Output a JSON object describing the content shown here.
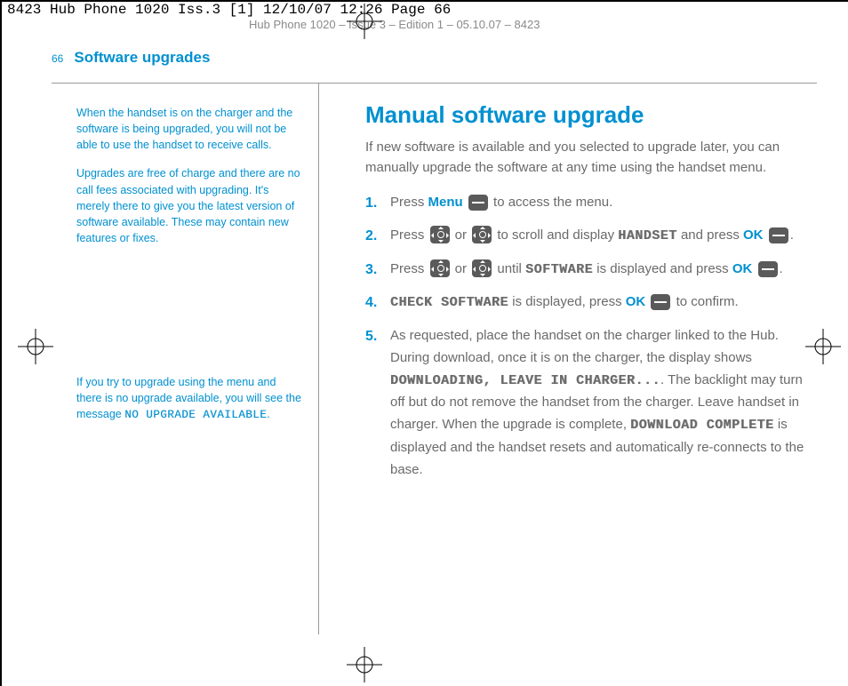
{
  "header": {
    "line1": "8423 Hub Phone 1020 Iss.3 [1]  12/10/07  12:26  Page 66",
    "line2": "Hub Phone 1020 – Issue 3 – Edition 1 – 05.10.07 – 8423"
  },
  "page_number": "66",
  "section_title": "Software upgrades",
  "sidebar": {
    "note1": "When the handset is on the charger and the software is being upgraded, you will not be able to use the handset to receive calls.",
    "note2": "Upgrades are free of charge and there are no call fees associated with upgrading. It's merely there to give you the latest version of software available. These may contain new features or fixes.",
    "note3_pre": "If you try to upgrade using the menu and there is no upgrade available, you will see the message ",
    "note3_lcd": "NO UPGRADE AVAILABLE",
    "note3_post": "."
  },
  "main": {
    "heading": "Manual software upgrade",
    "intro": "If new software is available and you selected to upgrade later, you can manually upgrade the software at any time using the handset menu.",
    "steps": {
      "s1_a": "Press ",
      "s1_menu": "Menu",
      "s1_b": " to access the menu.",
      "s2_a": "Press ",
      "s2_or": " or ",
      "s2_b": " to scroll and display ",
      "s2_lcd": "HANDSET",
      "s2_c": " and press ",
      "s2_ok": "OK",
      "s2_d": ".",
      "s3_a": "Press ",
      "s3_or": " or ",
      "s3_b": " until ",
      "s3_lcd": "SOFTWARE",
      "s3_c": " is displayed and press ",
      "s3_ok": "OK",
      "s3_d": ".",
      "s4_lcd": "CHECK SOFTWARE",
      "s4_a": " is displayed, press ",
      "s4_ok": "OK",
      "s4_b": " to confirm.",
      "s5_a": "As requested, place the handset on the charger linked to the Hub. During download, once it is on the charger, the display shows ",
      "s5_lcd1": "DOWNLOADING, LEAVE IN CHARGER...",
      "s5_b": ". The backlight may turn off but do not remove the handset from the charger. Leave handset in charger. When the upgrade is complete, ",
      "s5_lcd2": "DOWNLOAD COMPLETE",
      "s5_c": " is displayed and the handset resets and automatically re-connects to the base."
    }
  }
}
